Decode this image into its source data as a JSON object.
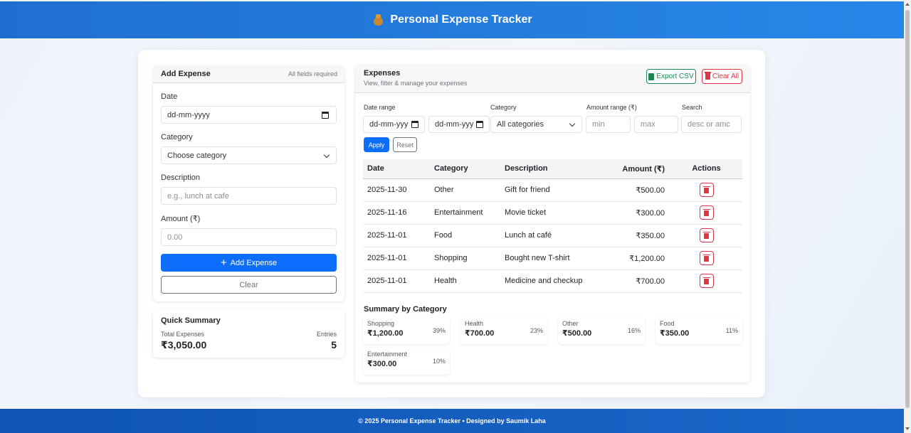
{
  "app": {
    "title": "Personal Expense Tracker"
  },
  "add_form": {
    "title": "Add Expense",
    "hint": "All fields required",
    "date_label": "Date",
    "date_placeholder": "dd-mm-yyyy",
    "category_label": "Category",
    "category_selected": "Choose category",
    "description_label": "Description",
    "description_placeholder": "e.g., lunch at cafe",
    "amount_label": "Amount (₹)",
    "amount_placeholder": "0.00",
    "add_button": "Add Expense",
    "clear_button": "Clear"
  },
  "quick_summary": {
    "title": "Quick Summary",
    "total_label": "Total Expenses",
    "total_value": "₹3,050.00",
    "entries_label": "Entries",
    "entries_value": "5"
  },
  "expenses": {
    "title": "Expenses",
    "subtitle": "View, filter & manage your expenses",
    "export_button": "Export CSV",
    "clear_all_button": "Clear All",
    "filters": {
      "date_range_label": "Date range",
      "date_from_placeholder": "dd-mm-yyy",
      "date_to_placeholder": "dd-mm-yyy",
      "category_label": "Category",
      "category_selected": "All categories",
      "amount_range_label": "Amount range (₹)",
      "min_placeholder": "min",
      "max_placeholder": "max",
      "search_label": "Search",
      "search_placeholder": "desc or amc",
      "apply_button": "Apply",
      "reset_button": "Reset"
    },
    "columns": [
      "Date",
      "Category",
      "Description",
      "Amount (₹)",
      "Actions"
    ],
    "rows": [
      {
        "date": "2025-11-30",
        "category": "Other",
        "description": "Gift for friend",
        "amount": "₹500.00"
      },
      {
        "date": "2025-11-16",
        "category": "Entertainment",
        "description": "Movie ticket",
        "amount": "₹300.00"
      },
      {
        "date": "2025-11-01",
        "category": "Food",
        "description": "Lunch at café",
        "amount": "₹350.00"
      },
      {
        "date": "2025-11-01",
        "category": "Shopping",
        "description": "Bought new T-shirt",
        "amount": "₹1,200.00"
      },
      {
        "date": "2025-11-01",
        "category": "Health",
        "description": "Medicine and checkup",
        "amount": "₹700.00"
      }
    ],
    "summary_title": "Summary by Category",
    "summary": [
      {
        "category": "Shopping",
        "amount": "₹1,200.00",
        "percent": "39%"
      },
      {
        "category": "Health",
        "amount": "₹700.00",
        "percent": "23%"
      },
      {
        "category": "Other",
        "amount": "₹500.00",
        "percent": "16%"
      },
      {
        "category": "Food",
        "amount": "₹350.00",
        "percent": "11%"
      },
      {
        "category": "Entertainment",
        "amount": "₹300.00",
        "percent": "10%"
      }
    ]
  },
  "footer": {
    "text": "© 2025 Personal Expense Tracker • Designed by Saumik Laha"
  },
  "colors": {
    "header": "#1f6fd1",
    "primary": "#0d6efd",
    "success": "#198754",
    "danger": "#dc3545",
    "footer": "#0f55b5"
  },
  "icons": [
    "money-bag-icon",
    "calendar-icon",
    "chevron-down-icon",
    "plus-icon",
    "file-export-icon",
    "trash-icon"
  ]
}
